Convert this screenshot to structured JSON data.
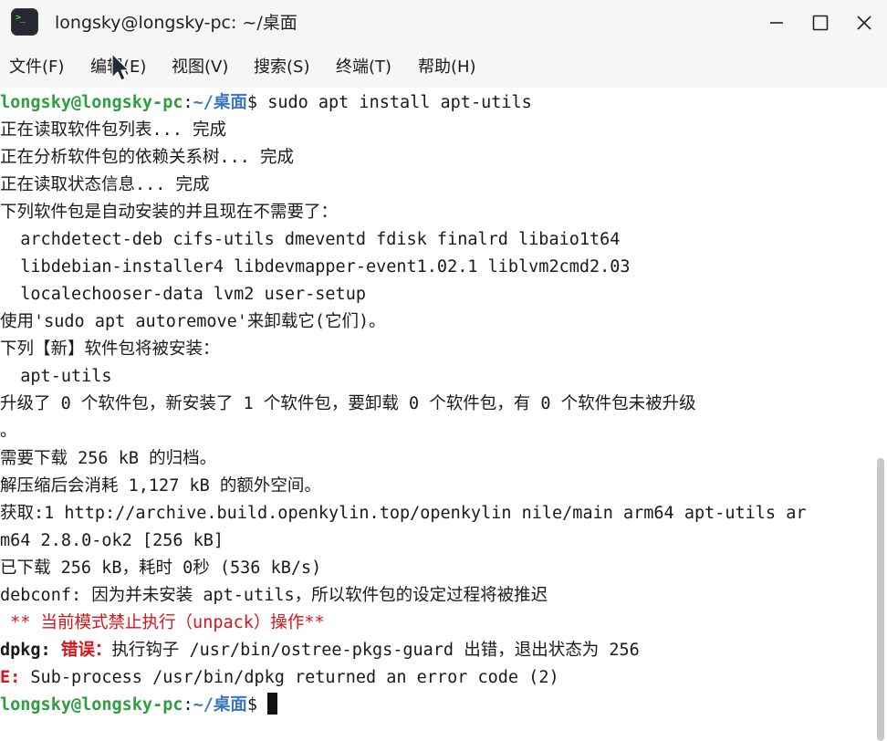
{
  "window": {
    "title": "longsky@longsky-pc: ~/桌面",
    "icon": "terminal-icon",
    "controls": [
      "minimize-icon",
      "maximize-icon",
      "close-icon"
    ]
  },
  "menu": [
    "文件(F)",
    "编辑(E)",
    "视图(V)",
    "搜索(S)",
    "终端(T)",
    "帮助(H)"
  ],
  "colors": {
    "prompt_user": "#2e9e3e",
    "prompt_path": "#3a76c4",
    "error": "#d9141a"
  },
  "prompt": {
    "user": "longsky@longsky-pc",
    "sep": ":",
    "path": "~/桌面",
    "sigil": "$ "
  },
  "terminal": {
    "command": "sudo apt install apt-utils",
    "lines": [
      "正在读取软件包列表... 完成",
      "正在分析软件包的依赖关系树... 完成",
      "正在读取状态信息... 完成",
      "下列软件包是自动安装的并且现在不需要了：",
      "  archdetect-deb cifs-utils dmeventd fdisk finalrd libaio1t64",
      "  libdebian-installer4 libdevmapper-event1.02.1 liblvm2cmd2.03",
      "  localechooser-data lvm2 user-setup",
      "使用'sudo apt autoremove'来卸载它(它们)。",
      "下列【新】软件包将被安装：",
      "  apt-utils",
      "升级了 0 个软件包，新安装了 1 个软件包，要卸载 0 个软件包，有 0 个软件包未被升级",
      "。",
      "需要下载 256 kB 的归档。",
      "解压缩后会消耗 1,127 kB 的额外空间。",
      "获取:1 http://archive.build.openkylin.top/openkylin nile/main arm64 apt-utils ar",
      "m64 2.8.0-ok2 [256 kB]",
      "已下载 256 kB，耗时 0秒 (536 kB/s)",
      "debconf: 因为并未安装 apt-utils，所以软件包的设定过程将被推迟"
    ],
    "mode_warning": " ** 当前模式禁止执行（unpack）操作**",
    "dpkg_error": {
      "prefix": "dpkg: ",
      "label": "错误：",
      "message": "执行钩子 /usr/bin/ostree-pkgs-guard 出错，退出状态为 256"
    },
    "e_error": {
      "prefix": "E:",
      "message": " Sub-process /usr/bin/dpkg returned an error code (2)"
    }
  }
}
